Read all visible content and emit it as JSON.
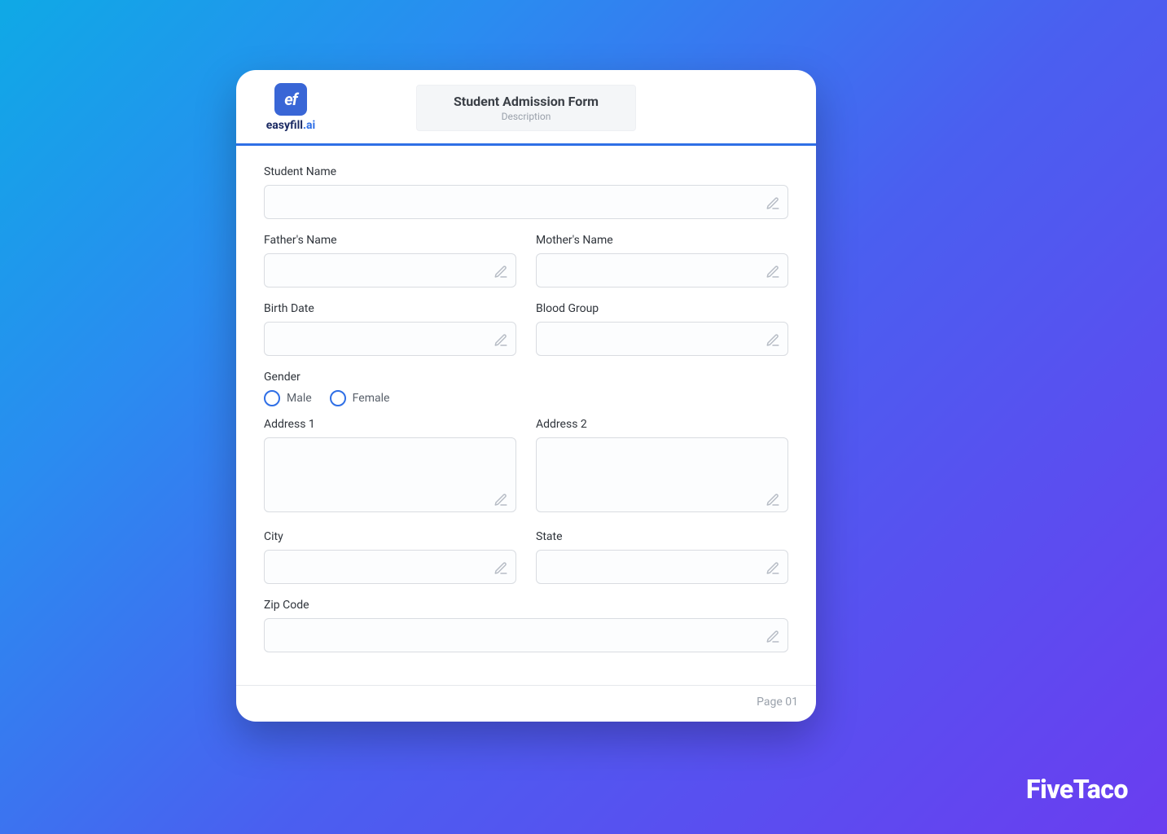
{
  "brand": {
    "icon_text": "ef",
    "name_main": "easyfill",
    "name_accent": ".ai"
  },
  "header": {
    "title": "Student Admission Form",
    "subtitle": "Description"
  },
  "fields": {
    "student_name": {
      "label": "Student Name",
      "value": ""
    },
    "fathers_name": {
      "label": "Father's Name",
      "value": ""
    },
    "mothers_name": {
      "label": "Mother's Name",
      "value": ""
    },
    "birth_date": {
      "label": "Birth Date",
      "value": ""
    },
    "blood_group": {
      "label": "Blood Group",
      "value": ""
    },
    "gender": {
      "label": "Gender",
      "options": [
        {
          "label": "Male",
          "selected": false
        },
        {
          "label": "Female",
          "selected": false
        }
      ]
    },
    "address1": {
      "label": "Address 1",
      "value": ""
    },
    "address2": {
      "label": "Address 2",
      "value": ""
    },
    "city": {
      "label": "City",
      "value": ""
    },
    "state": {
      "label": "State",
      "value": ""
    },
    "zip_code": {
      "label": "Zip Code",
      "value": ""
    }
  },
  "footer": {
    "page_label": "Page 01"
  },
  "watermark": "FiveTaco"
}
